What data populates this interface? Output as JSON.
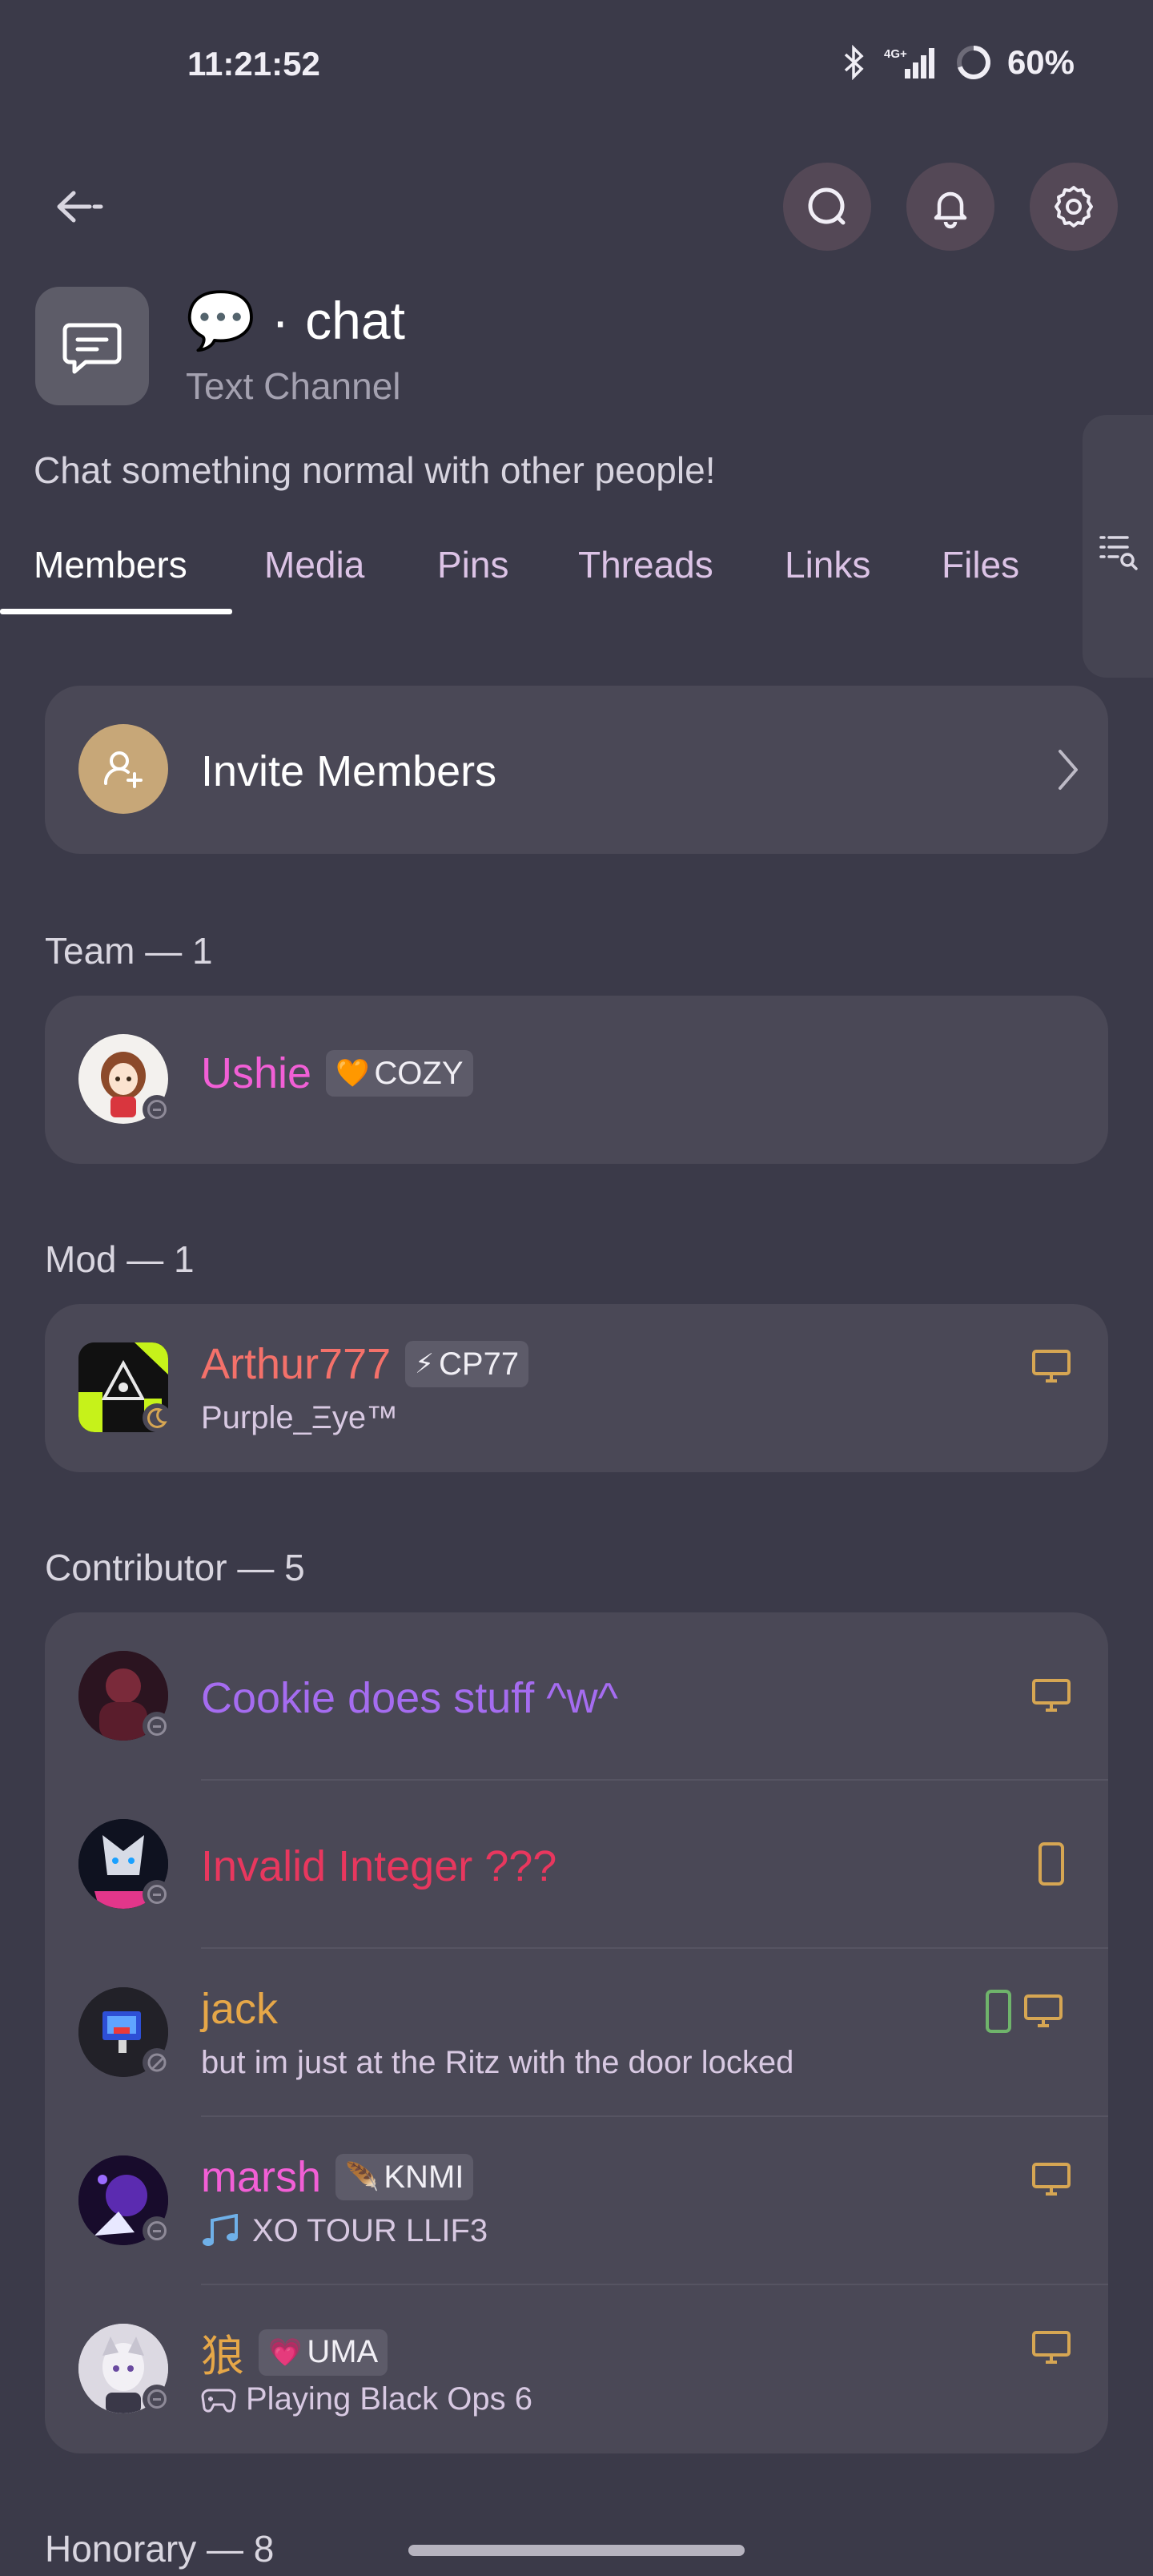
{
  "status_bar": {
    "time": "11:21:52",
    "network": "4G+",
    "battery": "60%"
  },
  "header": {
    "back_icon": "back-arrow-icon",
    "actions": [
      "search-icon",
      "bell-icon",
      "gear-icon"
    ]
  },
  "channel": {
    "emoji": "💬",
    "separator": "·",
    "name": "chat",
    "type": "Text Channel",
    "description": "Chat something normal with other people!"
  },
  "tabs": [
    "Members",
    "Media",
    "Pins",
    "Threads",
    "Links",
    "Files"
  ],
  "invite": {
    "label": "Invite Members"
  },
  "sections": {
    "team": {
      "label": "Team — 1"
    },
    "mod": {
      "label": "Mod — 1"
    },
    "contributor": {
      "label": "Contributor — 5"
    },
    "honorary": {
      "label": "Honorary — 8"
    }
  },
  "members": {
    "ushie": {
      "name": "Ushie",
      "tag_icon": "🧡",
      "tag": "COZY",
      "color": "#f25fd6"
    },
    "arthur": {
      "name": "Arthur777",
      "tag_icon": "⚡",
      "tag": "CP77",
      "activity": "Purple_Ξye™",
      "color": "#f4716a"
    },
    "cookie": {
      "name": "Cookie does stuff ^w^",
      "color": "#a56cf0"
    },
    "invalid": {
      "name": "Invalid Integer ???",
      "color": "#e8375e"
    },
    "jack": {
      "name": "jack",
      "activity": "but im just at the Ritz with the door locked",
      "color": "#e6a748"
    },
    "marsh": {
      "name": "marsh",
      "tag_icon": "🪶",
      "tag": "KNMI",
      "activity": "XO TOUR LLIF3",
      "color": "#f25fd6"
    },
    "wolf": {
      "name": "狼",
      "tag_icon": "💗",
      "tag": "UMA",
      "activity": "Playing Black Ops 6",
      "color": "#e6a748"
    }
  },
  "colors": {
    "background": "#3b3a49",
    "card": "#4a4856",
    "device_icon": "#d6a653",
    "mobile_online": "#6fb46b"
  }
}
